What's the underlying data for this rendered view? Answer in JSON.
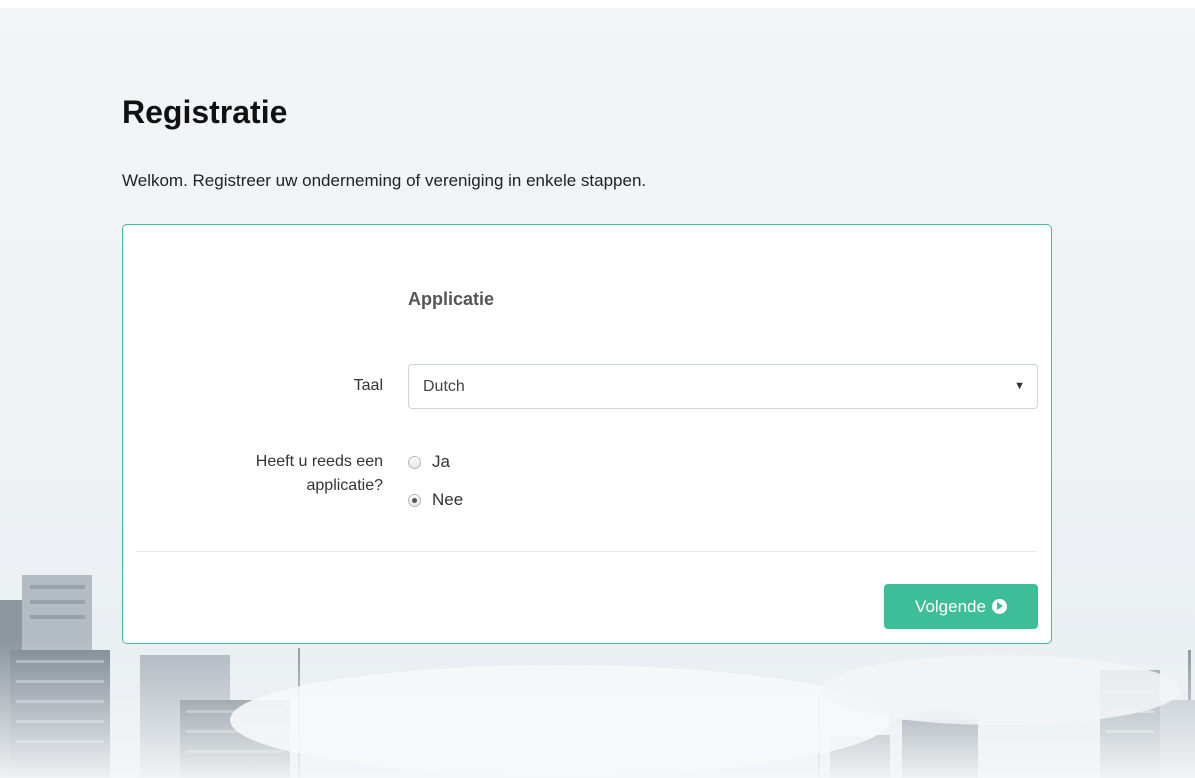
{
  "page": {
    "title": "Registratie",
    "subtitle": "Welkom. Registreer uw onderneming of vereniging in enkele stappen."
  },
  "form": {
    "section_title": "Applicatie",
    "language": {
      "label": "Taal",
      "selected": "Dutch"
    },
    "has_application": {
      "label_line1": "Heeft u reeds een",
      "label_line2": "applicatie?",
      "options": [
        {
          "label": "Ja",
          "checked": false
        },
        {
          "label": "Nee",
          "checked": true
        }
      ]
    },
    "next_button": {
      "label": "Volgende",
      "icon": "circle-arrow-right-icon"
    }
  },
  "colors": {
    "accent": "#3dbd98",
    "background": "#eef2f5",
    "panel": "#ffffff"
  }
}
